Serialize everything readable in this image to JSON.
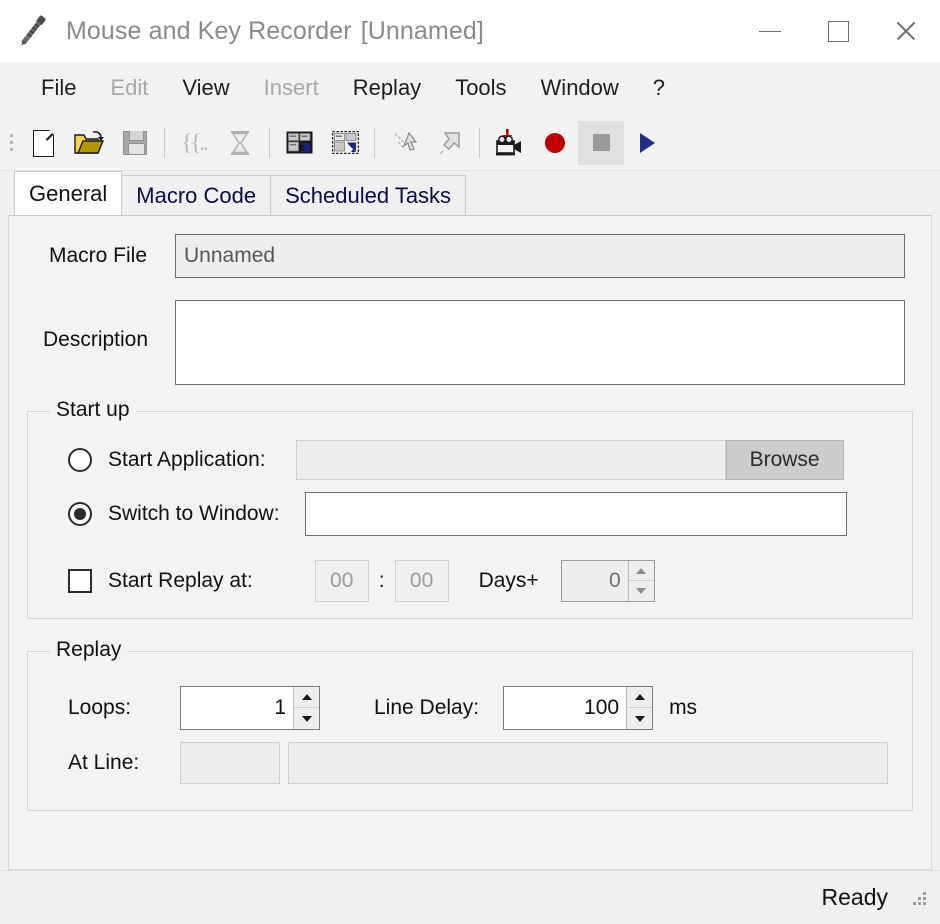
{
  "window": {
    "app_title": "Mouse and Key Recorder",
    "document_title": "[Unnamed]",
    "icon": "key-icon",
    "controls": {
      "minimize": "minimize-icon",
      "maximize": "maximize-icon",
      "close": "close-icon"
    }
  },
  "menubar": {
    "items": [
      {
        "label": "File",
        "enabled": true
      },
      {
        "label": "Edit",
        "enabled": false
      },
      {
        "label": "View",
        "enabled": true
      },
      {
        "label": "Insert",
        "enabled": false
      },
      {
        "label": "Replay",
        "enabled": true
      },
      {
        "label": "Tools",
        "enabled": true
      },
      {
        "label": "Window",
        "enabled": true
      },
      {
        "label": "?",
        "enabled": true
      }
    ]
  },
  "toolbar": {
    "buttons": [
      {
        "name": "new-icon",
        "title": "New"
      },
      {
        "name": "open-folder-icon",
        "title": "Open"
      },
      {
        "name": "save-floppy-icon",
        "title": "Save"
      },
      {
        "name": "braces-icon",
        "title": "Insert Block"
      },
      {
        "name": "hourglass-icon",
        "title": "Insert Delay"
      },
      {
        "name": "window-capture-icon",
        "title": "Window Capture"
      },
      {
        "name": "window-capture-alt-icon",
        "title": "Window Capture Alt"
      },
      {
        "name": "mouse-path-down-icon",
        "title": "Mouse Move Down"
      },
      {
        "name": "mouse-path-up-icon",
        "title": "Mouse Move Up"
      },
      {
        "name": "camera-record-icon",
        "title": "Record Screen"
      },
      {
        "name": "record-dot-icon",
        "title": "Record"
      },
      {
        "name": "stop-square-icon",
        "title": "Stop"
      },
      {
        "name": "play-triangle-icon",
        "title": "Play"
      }
    ]
  },
  "tabs": [
    {
      "label": "General",
      "active": true
    },
    {
      "label": "Macro Code",
      "active": false
    },
    {
      "label": "Scheduled Tasks",
      "active": false
    }
  ],
  "general": {
    "macro_file": {
      "label": "Macro File",
      "value": "Unnamed",
      "placeholder": ""
    },
    "description": {
      "label": "Description",
      "value": "",
      "placeholder": ""
    },
    "startup": {
      "legend": "Start up",
      "start_application": {
        "label": "Start Application:",
        "selected": false,
        "value": "",
        "placeholder": "",
        "browse_label": "Browse"
      },
      "switch_to_window": {
        "label": "Switch to Window:",
        "selected": true,
        "value": "",
        "placeholder": ""
      },
      "start_replay_at": {
        "label": "Start Replay at:",
        "checked": false,
        "hours": "00",
        "separator": ":",
        "minutes": "00",
        "days_label": "Days+",
        "days_value": "0"
      }
    },
    "replay": {
      "legend": "Replay",
      "loops": {
        "label": "Loops:",
        "value": "1"
      },
      "line_delay": {
        "label": "Line Delay:",
        "value": "100",
        "unit": "ms"
      },
      "at_line": {
        "label": "At Line:",
        "value": "",
        "text_value": ""
      }
    }
  },
  "statusbar": {
    "text": "Ready",
    "grip": "resize-grip-icon"
  },
  "colors": {
    "window_bg": "#f0f0f0",
    "panel_bg": "#f3f3f3",
    "title_text": "#8a8a8a",
    "tab_text": "#0a0a4a",
    "record_red": "#c00000",
    "play_blue": "#1f2f8f",
    "folder_yellow": "#e8c11c"
  }
}
